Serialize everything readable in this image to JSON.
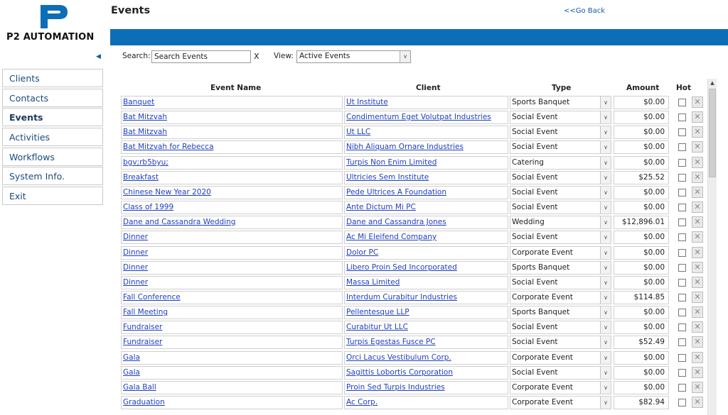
{
  "brand": {
    "name": "P2 AUTOMATION",
    "logo_mark": "P2"
  },
  "page": {
    "title": "Events",
    "go_back": "<<Go Back"
  },
  "sidebar": {
    "items": [
      {
        "label": "Clients"
      },
      {
        "label": "Contacts"
      },
      {
        "label": "Events",
        "active": true
      },
      {
        "label": "Activities"
      },
      {
        "label": "Workflows"
      },
      {
        "label": "System Info."
      },
      {
        "label": "Exit"
      }
    ]
  },
  "search": {
    "label": "Search:",
    "value": "Search Events",
    "clear": "X"
  },
  "view": {
    "label": "View:",
    "value": "Active Events"
  },
  "table": {
    "columns": {
      "name": "Event Name",
      "client": "Client",
      "type": "Type",
      "amount": "Amount",
      "hot": "Hot"
    },
    "rows": [
      {
        "name": "Banquet",
        "client": "Ut Institute",
        "type": "Sports Banquet",
        "amount": "$0.00"
      },
      {
        "name": "Bat Mitzvah",
        "client": "Condimentum Eget Volutpat Industries",
        "type": "Social Event",
        "amount": "$0.00"
      },
      {
        "name": "Bat Mitzvah",
        "client": "Ut LLC",
        "type": "Social Event",
        "amount": "$0.00"
      },
      {
        "name": "Bat Mitzvah for Rebecca",
        "client": "Nibh Aliquam Ornare Industries",
        "type": "Social Event",
        "amount": "$0.00"
      },
      {
        "name": "bgv;rb5byu;",
        "client": "Turpis Non Enim Limited",
        "type": "Catering",
        "amount": "$0.00"
      },
      {
        "name": "Breakfast",
        "client": "Ultricies Sem Institute",
        "type": "Social Event",
        "amount": "$25.52"
      },
      {
        "name": "Chinese New Year 2020",
        "client": "Pede Ultrices A Foundation",
        "type": "Social Event",
        "amount": "$0.00"
      },
      {
        "name": "Class of 1999",
        "client": "Ante Dictum Mi PC",
        "type": "Social Event",
        "amount": "$0.00"
      },
      {
        "name": "Dane and Cassandra Wedding",
        "client": "Dane and Cassandra Jones",
        "type": "Wedding",
        "amount": "$12,896.01"
      },
      {
        "name": "Dinner",
        "client": "Ac Mi Eleifend Company",
        "type": "Social Event",
        "amount": "$0.00"
      },
      {
        "name": "Dinner",
        "client": "Dolor PC",
        "type": "Corporate Event",
        "amount": "$0.00"
      },
      {
        "name": "Dinner",
        "client": "Libero Proin Sed Incorporated",
        "type": "Sports Banquet",
        "amount": "$0.00"
      },
      {
        "name": "Dinner",
        "client": "Massa Limited",
        "type": "Social Event",
        "amount": "$0.00"
      },
      {
        "name": "Fall Conference",
        "client": "Interdum Curabitur Industries",
        "type": "Corporate Event",
        "amount": "$114.85"
      },
      {
        "name": "Fall Meeting",
        "client": "Pellentesque LLP",
        "type": "Sports Banquet",
        "amount": "$0.00"
      },
      {
        "name": "Fundraiser",
        "client": "Curabitur Ut LLC",
        "type": "Social Event",
        "amount": "$0.00"
      },
      {
        "name": "Fundraiser",
        "client": "Turpis Egestas Fusce PC",
        "type": "Social Event",
        "amount": "$52.49"
      },
      {
        "name": "Gala",
        "client": "Orci Lacus Vestibulum Corp.",
        "type": "Corporate Event",
        "amount": "$0.00"
      },
      {
        "name": "Gala",
        "client": "Sagittis Lobortis Corporation",
        "type": "Social Event",
        "amount": "$0.00"
      },
      {
        "name": "Gala Ball",
        "client": "Proin Sed Turpis Industries",
        "type": "Corporate Event",
        "amount": "$0.00"
      },
      {
        "name": "Graduation",
        "client": "Ac Corp.",
        "type": "Corporate Event",
        "amount": "$82.94"
      }
    ]
  },
  "colors": {
    "accent_bar": "#0d6eb8",
    "link": "#1f3fbf",
    "logo_blue": "#0d6eb8"
  },
  "icons": {
    "collapse": "triangle-left-icon",
    "dropdown": "chevron-down-icon",
    "delete": "x-icon",
    "scroll_up": "triangle-up-icon"
  }
}
